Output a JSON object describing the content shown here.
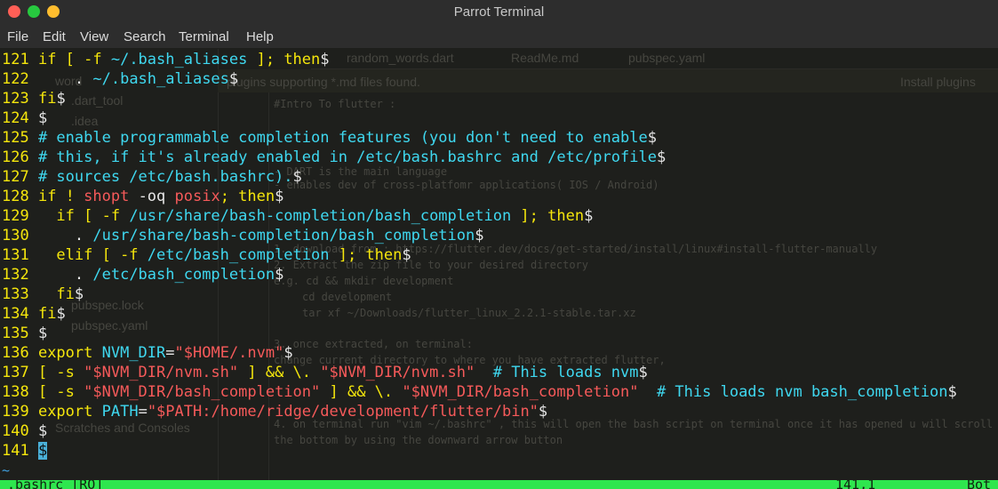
{
  "window": {
    "title": "Parrot Terminal"
  },
  "menu": [
    "File",
    "Edit",
    "View",
    "Search",
    "Terminal",
    "Help"
  ],
  "background_ide": {
    "tabs": [
      "random_words.dart",
      "ReadMe.md",
      "pubspec.yaml"
    ],
    "banner": "plugins supporting *.md files found.",
    "banner_action": "Install plugins",
    "sidebar": [
      "word",
      ".dart_tool",
      ".idea",
      "pubspec.lock",
      "pubspec.yaml",
      "Scratches and Consoles"
    ],
    "editor_lines": [
      "#Intro To flutter :",
      "- DART is the main language",
      "- enables dev of cross-platfomr applications( IOS / Android)",
      "1. download from : https://flutter.dev/docs/get-started/install/linux#install-flutter-manually",
      "2. Extract the zip file to your desired directory",
      "e.g. cd && mkdir development",
      "cd development",
      "tar xf ~/Downloads/flutter_linux_2.2.1-stable.tar.xz",
      "3. once extracted, on terminal:",
      "change current directory to where you have extracted flutter,",
      "4. on terminal run \"vim ~/.bashrc\" , this will open the bash script on terminal  once it has opened u will scroll till",
      "the bottom by using the downward arrow button"
    ]
  },
  "terminal": {
    "lines": [
      {
        "n": "121",
        "segs": [
          [
            "kw",
            "if [ -f "
          ],
          [
            "var",
            "~/.bash_aliases"
          ],
          [
            "kw",
            " ]; then"
          ]
        ]
      },
      {
        "n": "122",
        "segs": [
          [
            "tx",
            "    . "
          ],
          [
            "var",
            "~/.bash_aliases"
          ]
        ]
      },
      {
        "n": "123",
        "segs": [
          [
            "kw",
            "fi"
          ]
        ]
      },
      {
        "n": "124",
        "segs": []
      },
      {
        "n": "125",
        "segs": [
          [
            "cm",
            "# enable programmable completion features (you don't need to enable"
          ]
        ]
      },
      {
        "n": "126",
        "segs": [
          [
            "cm",
            "# this, if it's already enabled in /etc/bash.bashrc and /etc/profile"
          ]
        ]
      },
      {
        "n": "127",
        "segs": [
          [
            "cm",
            "# sources /etc/bash.bashrc)."
          ]
        ]
      },
      {
        "n": "128",
        "segs": [
          [
            "kw",
            "if ! "
          ],
          [
            "str",
            "shopt"
          ],
          [
            "tx",
            " -oq "
          ],
          [
            "str",
            "posix"
          ],
          [
            "kw",
            "; then"
          ]
        ]
      },
      {
        "n": "129",
        "segs": [
          [
            "kw",
            "  if [ -f "
          ],
          [
            "var",
            "/usr/share/bash-completion/bash_completion"
          ],
          [
            "kw",
            " ]; then"
          ]
        ]
      },
      {
        "n": "130",
        "segs": [
          [
            "tx",
            "    . "
          ],
          [
            "var",
            "/usr/share/bash-completion/bash_completion"
          ]
        ]
      },
      {
        "n": "131",
        "segs": [
          [
            "kw",
            "  elif [ -f "
          ],
          [
            "var",
            "/etc/bash_completion"
          ],
          [
            "kw",
            " ]; then"
          ]
        ]
      },
      {
        "n": "132",
        "segs": [
          [
            "tx",
            "    . "
          ],
          [
            "var",
            "/etc/bash_completion"
          ]
        ]
      },
      {
        "n": "133",
        "segs": [
          [
            "kw",
            "  fi"
          ]
        ]
      },
      {
        "n": "134",
        "segs": [
          [
            "kw",
            "fi"
          ]
        ]
      },
      {
        "n": "135",
        "segs": []
      },
      {
        "n": "136",
        "segs": [
          [
            "kw",
            "export "
          ],
          [
            "var",
            "NVM_DIR"
          ],
          [
            "tx",
            "="
          ],
          [
            "str",
            "\"$HOME"
          ],
          [
            "str",
            "/.nvm\""
          ]
        ]
      },
      {
        "n": "137",
        "segs": [
          [
            "kw",
            "[ -s "
          ],
          [
            "str",
            "\"$NVM_DIR/nvm.sh\""
          ],
          [
            "kw",
            " ] && \\. "
          ],
          [
            "str",
            "\"$NVM_DIR/nvm.sh\""
          ],
          [
            "cm",
            "  # This loads nvm"
          ]
        ]
      },
      {
        "n": "138",
        "segs": [
          [
            "kw",
            "[ -s "
          ],
          [
            "str",
            "\"$NVM_DIR/bash_completion\""
          ],
          [
            "kw",
            " ] && \\. "
          ],
          [
            "str",
            "\"$NVM_DIR/bash_completion\""
          ],
          [
            "cm",
            "  # This loads nvm bash_completion"
          ]
        ]
      },
      {
        "n": "139",
        "segs": [
          [
            "kw",
            "export "
          ],
          [
            "var",
            "PATH"
          ],
          [
            "tx",
            "="
          ],
          [
            "str",
            "\"$PATH:/home/ridge/development/flutter/bin\""
          ]
        ]
      },
      {
        "n": "140",
        "segs": []
      },
      {
        "n": "141",
        "segs": [],
        "cursor": true
      }
    ],
    "eol_marker": "$",
    "tilde": "~",
    "status_left": ".bashrc [RO]",
    "status_mid": "141,1",
    "status_right": "Bot"
  }
}
